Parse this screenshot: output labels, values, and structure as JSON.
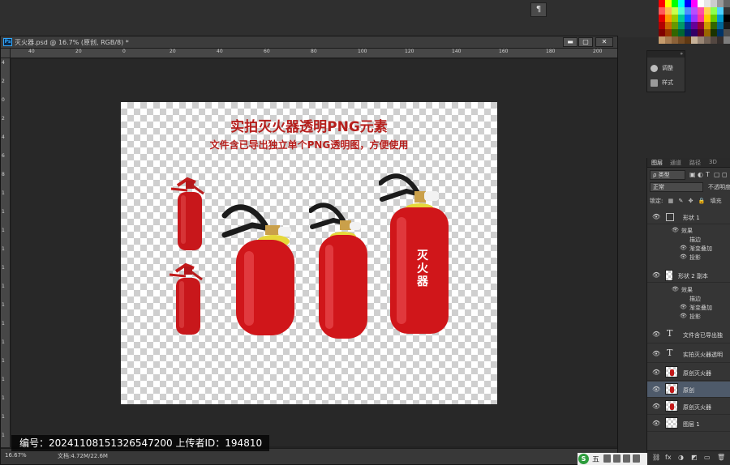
{
  "topbar": {
    "button_glyph": "¶"
  },
  "swatch_colors": [
    "#ff0000",
    "#ffff00",
    "#00ff00",
    "#00ffff",
    "#0000ff",
    "#ff00ff",
    "#ffffff",
    "#e6e6e6",
    "#cccccc",
    "#999999",
    "#666666",
    "#ff5a5a",
    "#ffb84d",
    "#c8ff4d",
    "#4dffd2",
    "#4d8fff",
    "#b84dff",
    "#ff4da6",
    "#ffd24d",
    "#8cff4d",
    "#4dd2ff",
    "#333333",
    "#e60000",
    "#ff9900",
    "#99cc00",
    "#00cc99",
    "#0066ff",
    "#9933ff",
    "#ff3399",
    "#ffcc00",
    "#66cc00",
    "#0099cc",
    "#000000",
    "#b30000",
    "#cc6600",
    "#669900",
    "#009966",
    "#003399",
    "#660099",
    "#990033",
    "#cc9900",
    "#336600",
    "#006699",
    "#1a1a1a",
    "#800000",
    "#993300",
    "#336600",
    "#006633",
    "#002266",
    "#330066",
    "#660022",
    "#996600",
    "#1a3300",
    "#003366",
    "#4d4d4d",
    "#c69c6d",
    "#a67c52",
    "#8c6239",
    "#754c24",
    "#603913",
    "#c7b299",
    "#998675",
    "#736357",
    "#534741",
    "#362f2d",
    "#7d7d7d"
  ],
  "document": {
    "title": "灭火器.psd @ 16.7% (原创, RGB/8) *",
    "ps_badge": "Ps",
    "min_glyph": "▬",
    "max_glyph": "▢",
    "close_glyph": "✕",
    "ruler_h": [
      "40",
      "20",
      "0",
      "20",
      "40",
      "60",
      "80",
      "100",
      "120",
      "140",
      "160",
      "180",
      "200"
    ],
    "ruler_v": [
      "4",
      "2",
      "0",
      "2",
      "4",
      "6",
      "8",
      "1",
      "1",
      "1",
      "1",
      "1",
      "1",
      "1",
      "1",
      "1",
      "1",
      "1",
      "1",
      "1",
      "1"
    ],
    "zoom": "16.67%",
    "doc_size": "文档:4.72M/22.6M"
  },
  "canvas": {
    "title": "实拍灭火器透明PNG元素",
    "subtitle": "文件含已导出独立单个PNG透明图，方便使用",
    "extinguisher_label": [
      "灭",
      "火",
      "器"
    ]
  },
  "watermark": "编号：20241108151326547200   上传者ID：194810",
  "adjust_panel": {
    "head": "»",
    "items": [
      {
        "label": "调整",
        "icon": "adjust-icon"
      },
      {
        "label": "样式",
        "icon": "style-icon"
      }
    ]
  },
  "layers": {
    "tabs": [
      "图层",
      "通道",
      "路径",
      "3D"
    ],
    "filter_label": "ρ 类型",
    "filter_icons": [
      "▣",
      "◐",
      "T",
      "▢",
      "◻"
    ],
    "blend_mode": "正常",
    "opacity_label": "不透明度",
    "lock_label": "锁定:",
    "lock_icons": [
      "▦",
      "✎",
      "✥",
      "🔒"
    ],
    "fill_label": "填充",
    "rows": [
      {
        "name": "形状 1",
        "kind": "shape",
        "effects_label": "效果",
        "effects": [
          "描边",
          "渐变叠加",
          "投影"
        ]
      },
      {
        "name": "形状 2 副本",
        "kind": "shape",
        "effects_label": "效果",
        "effects": [
          "描边",
          "渐变叠加",
          "投影"
        ]
      },
      {
        "name": "文件含已导出独",
        "kind": "text"
      },
      {
        "name": "实拍灭火器透明",
        "kind": "text"
      },
      {
        "name": "原创灭火器",
        "kind": "image"
      },
      {
        "name": "原创",
        "kind": "image",
        "selected": true
      },
      {
        "name": "原创灭火器",
        "kind": "image"
      },
      {
        "name": "图层 1",
        "kind": "image"
      }
    ],
    "footer_icons": [
      "⛓",
      "fx",
      "◑",
      "◩",
      "▭",
      "🗑"
    ]
  },
  "tray": {
    "s_badge": "S",
    "text": "五"
  },
  "colors": {
    "accent_red": "#b61f1c",
    "extinguisher_red": "#d0161a"
  }
}
